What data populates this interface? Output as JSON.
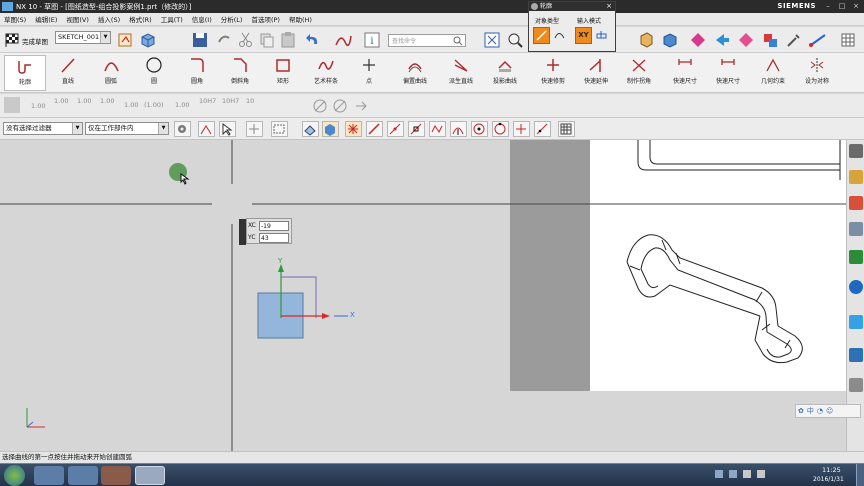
{
  "window": {
    "title": "NX 10 - 草图 - [图纸造型-组合投影案例1.prt（修改的）]",
    "brand": "SIEMENS"
  },
  "menu": [
    "草图(S)",
    "编辑(E)",
    "视图(V)",
    "插入(S)",
    "格式(R)",
    "工具(T)",
    "信息(I)",
    "分析(L)",
    "首选项(P)",
    "帮助(H)"
  ],
  "toolbar": {
    "finish_sketch_label": "完成草图",
    "sketch_name": "SKETCH_001",
    "search_placeholder": "查找命令"
  },
  "ribbon": {
    "items": [
      "轮廓",
      "直线",
      "圆弧",
      "圆",
      "圆角",
      "倒斜角",
      "矩形",
      "艺术样条",
      "点",
      "偏置曲线",
      "派生直线",
      "投影曲线",
      "快速修剪",
      "快速延伸",
      "制作拐角",
      "快速尺寸",
      "快速尺寸",
      "几何约束",
      "设为对称"
    ]
  },
  "dimension_bar": [
    "1.00",
    "1.00",
    "1.00",
    "1.00",
    "1.00",
    "(1.00)",
    "1.00",
    "10H7",
    "10H7",
    "10"
  ],
  "selection_bar": {
    "filter_value": "没有选择过滤器",
    "scope_value": "仅在工作部件内"
  },
  "profile_popup": {
    "title": "轮廓",
    "object_type_label": "对象类型",
    "input_mode_label": "输入模式",
    "xy_label": "XY"
  },
  "coord_input": {
    "xc_label": "XC",
    "xc_value": "-19",
    "yc_label": "YC",
    "yc_value": "43"
  },
  "triad": {
    "x_label": "X",
    "y_label": "Y"
  },
  "status_bar": {
    "message": "选择曲线的第一点按住并拖动来开始创建圆弧"
  },
  "ime_bar": {
    "text": "中"
  },
  "taskbar": {
    "time": "11:25",
    "date": "2016/1/31"
  },
  "colors": {
    "accent": "#f08a1c",
    "titlebar": "#2b2b2b",
    "canvas": "#d6d6d6",
    "drawing_sheet": "#ffffff",
    "axis_blue": "#2f6fd6",
    "axis_green": "#2a9b3a",
    "axis_red": "#d52a2a"
  }
}
